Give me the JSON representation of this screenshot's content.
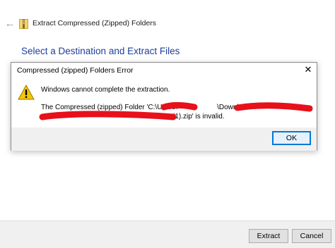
{
  "wizard": {
    "title": "Extract Compressed (Zipped) Folders",
    "heading": "Select a Destination and Extract Files",
    "back_icon": "back-arrow-icon",
    "folder_icon": "zip-folder-icon",
    "extract_label": "Extract",
    "cancel_label": "Cancel"
  },
  "dialog": {
    "title": "Compressed (zipped) Folders Error",
    "close_glyph": "✕",
    "message": "Windows cannot complete the extraction.",
    "detail_line1": "The Compressed (zipped) Folder 'C:\\Users\\",
    "detail_line1_part2": "\\Downloads\\",
    "detail_line2": "(1).zip' is invalid.",
    "ok_label": "OK",
    "icon": "warning-icon"
  },
  "colors": {
    "heading_blue": "#1f3d9a",
    "redaction_red": "#e8101a",
    "warning_yellow": "#f7c700",
    "ok_border": "#0078d7"
  }
}
